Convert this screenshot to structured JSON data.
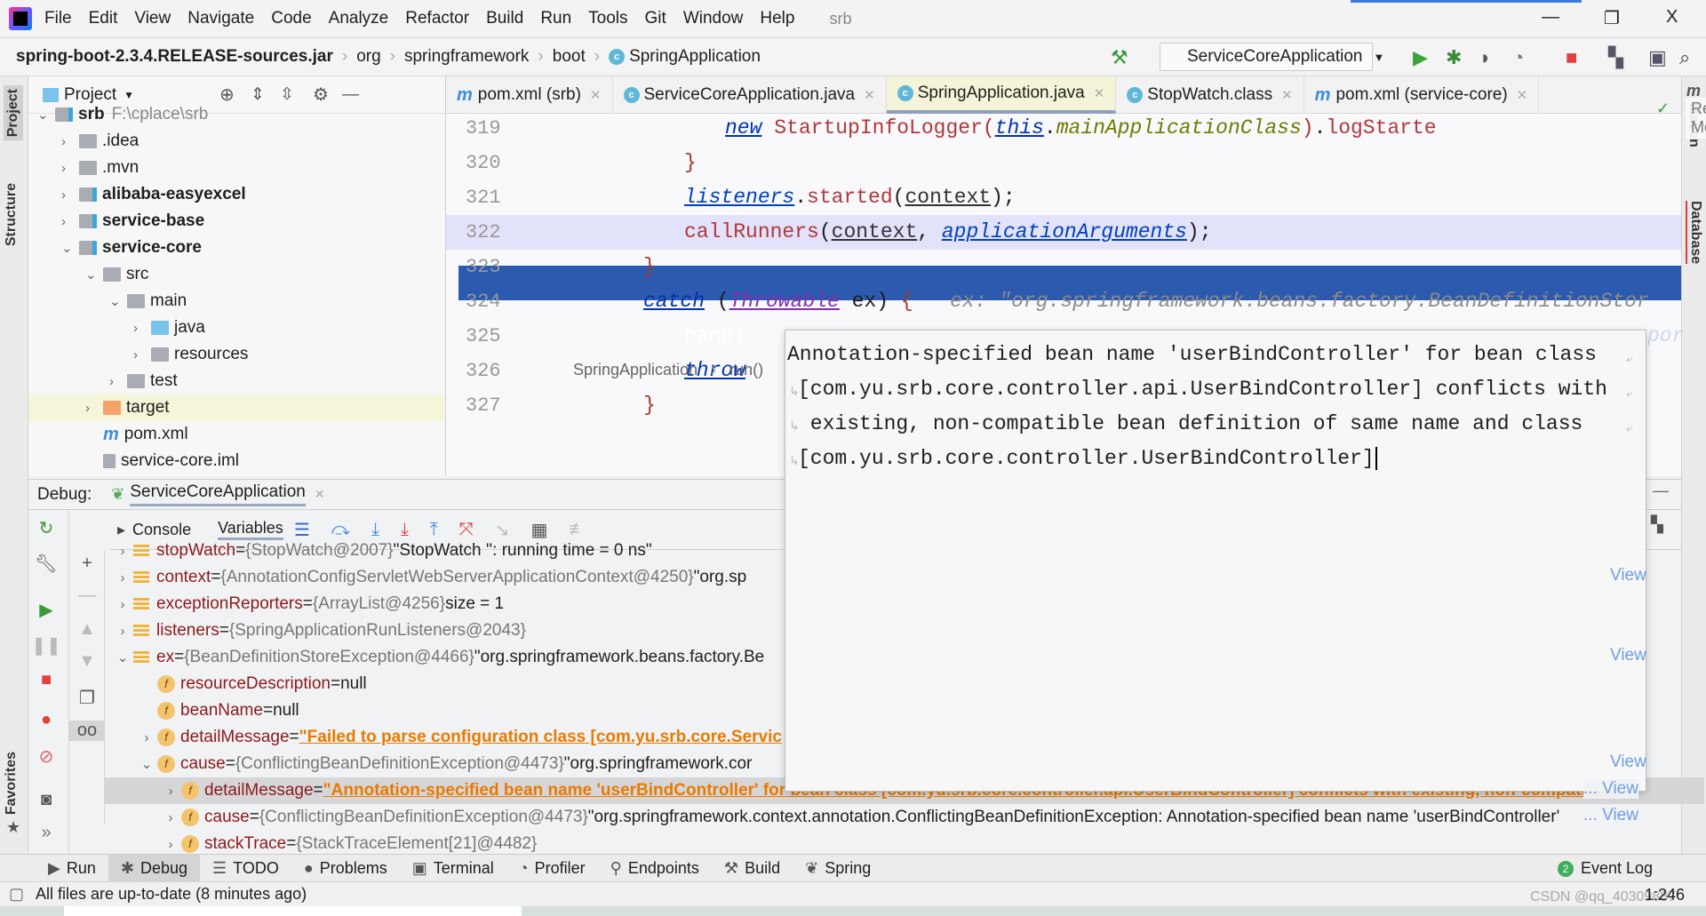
{
  "menu": {
    "items": [
      "File",
      "Edit",
      "View",
      "Navigate",
      "Code",
      "Analyze",
      "Refactor",
      "Build",
      "Run",
      "Tools",
      "Git",
      "Window",
      "Help"
    ],
    "project": "srb"
  },
  "window": {
    "minimize": "—",
    "restore": "❐",
    "close": "X"
  },
  "navbar": {
    "crumbs": [
      "spring-boot-2.3.4.RELEASE-sources.jar",
      "org",
      "springframework",
      "boot",
      "SpringApplication"
    ]
  },
  "toolbar": {
    "run_config": "ServiceCoreApplication"
  },
  "left_strip": {
    "tabs": [
      "Project",
      "Structure",
      "Favorites"
    ]
  },
  "right_strip": {
    "tabs": [
      "Maven",
      "Database"
    ]
  },
  "project": {
    "title": "Project",
    "tree": [
      {
        "name": "srb",
        "extra": "F:\\cplace\\srb",
        "level": 0,
        "arrow": "open",
        "icon": "module",
        "bold": true
      },
      {
        "name": ".idea",
        "level": 1,
        "arrow": "closed",
        "icon": "folder"
      },
      {
        "name": ".mvn",
        "level": 1,
        "arrow": "closed",
        "icon": "folder"
      },
      {
        "name": "alibaba-easyexcel",
        "level": 1,
        "arrow": "closed",
        "icon": "module",
        "bold": true
      },
      {
        "name": "service-base",
        "level": 1,
        "arrow": "closed",
        "icon": "module",
        "bold": true
      },
      {
        "name": "service-core",
        "level": 1,
        "arrow": "open",
        "icon": "module",
        "bold": true
      },
      {
        "name": "src",
        "level": 2,
        "arrow": "open",
        "icon": "folder"
      },
      {
        "name": "main",
        "level": 3,
        "arrow": "open",
        "icon": "folder"
      },
      {
        "name": "java",
        "level": 4,
        "arrow": "closed",
        "icon": "folder-blue"
      },
      {
        "name": "resources",
        "level": 4,
        "arrow": "closed",
        "icon": "folder"
      },
      {
        "name": "test",
        "level": 3,
        "arrow": "closed",
        "icon": "folder"
      },
      {
        "name": "target",
        "level": 2,
        "arrow": "closed",
        "icon": "folder-orange",
        "highlight": true
      },
      {
        "name": "pom.xml",
        "level": 2,
        "arrow": "none",
        "icon": "maven"
      },
      {
        "name": "service-core.iml",
        "level": 2,
        "arrow": "none",
        "icon": "file"
      }
    ]
  },
  "editor": {
    "tabs": [
      {
        "label": "pom.xml (srb)",
        "icon": "maven"
      },
      {
        "label": "ServiceCoreApplication.java",
        "icon": "class"
      },
      {
        "label": "SpringApplication.java",
        "icon": "class",
        "active": true
      },
      {
        "label": "StopWatch.class",
        "icon": "class"
      },
      {
        "label": "pom.xml (service-core)",
        "icon": "maven"
      }
    ],
    "reader_mode": "Reader Mode",
    "lines": [
      {
        "n": "319",
        "tokens": [
          [
            "new",
            "kw"
          ],
          [
            " ",
            ""
          ],
          [
            "StartupInfoLogger",
            "fn"
          ],
          [
            "(",
            "br"
          ],
          [
            "this",
            "kw"
          ],
          [
            ".",
            ""
          ],
          [
            "mainApplicationClass",
            "fld"
          ],
          [
            ")",
            "br"
          ],
          [
            ".",
            ""
          ],
          [
            "logStarte",
            "fn"
          ]
        ]
      },
      {
        "n": "320",
        "tokens": [
          [
            "}",
            "br"
          ]
        ]
      },
      {
        "n": "321",
        "tokens": [
          [
            "listeners",
            "var"
          ],
          [
            ".",
            ""
          ],
          [
            "started",
            "fn"
          ],
          [
            "(",
            ""
          ],
          [
            "context",
            "u"
          ],
          [
            ");",
            ""
          ]
        ]
      },
      {
        "n": "322",
        "highlight": true,
        "tokens": [
          [
            "callRunners",
            "fn"
          ],
          [
            "(",
            ""
          ],
          [
            "context",
            "u"
          ],
          [
            ", ",
            ""
          ],
          [
            "applicationArguments",
            "var"
          ],
          [
            ");",
            ""
          ]
        ]
      },
      {
        "n": "323",
        "tokens": [
          [
            "}",
            "br"
          ]
        ]
      },
      {
        "n": "324",
        "tokens": [
          [
            "catch",
            "kw"
          ],
          [
            " (",
            ""
          ],
          [
            "Throwable",
            "ty"
          ],
          [
            " ex) ",
            ""
          ],
          [
            "{",
            "br"
          ],
          [
            "   ex: \"org.springframework.beans.factory.BeanDefinitionStor",
            "cm"
          ]
        ]
      },
      {
        "n": "325",
        "selected": true,
        "tokens": [
          [
            "handl",
            "sel"
          ]
        ]
      },
      {
        "n": "326",
        "tokens": [
          [
            "throw",
            "kw"
          ]
        ]
      },
      {
        "n": "327",
        "tokens": [
          [
            "}",
            "br"
          ]
        ]
      }
    ],
    "line325_tail": "por",
    "breadcrumb": [
      "SpringApplication",
      "run()"
    ]
  },
  "popup": {
    "lines": [
      "Annotation-specified bean name 'userBindController' for bean class",
      "[com.yu.srb.core.controller.api.UserBindController] conflicts with",
      " existing, non-compatible bean definition of same name and class",
      "[com.yu.srb.core.controller.UserBindController]"
    ]
  },
  "debug": {
    "label": "Debug:",
    "session": "ServiceCoreApplication",
    "tabs": [
      "Console",
      "Variables"
    ],
    "variables": [
      {
        "level": 0,
        "arrow": "closed",
        "icon": "local",
        "name": "stopWatch",
        "type": "{StopWatch@2007}",
        "value": "\"StopWatch '': running time = 0 ns\""
      },
      {
        "level": 0,
        "arrow": "closed",
        "icon": "local",
        "name": "context",
        "type": "{AnnotationConfigServletWebServerApplicationContext@4250}",
        "value": "\"org.sp",
        "view": "View"
      },
      {
        "level": 0,
        "arrow": "closed",
        "icon": "local",
        "name": "exceptionReporters",
        "type": "{ArrayList@4256}",
        "value": "size = 1"
      },
      {
        "level": 0,
        "arrow": "closed",
        "icon": "local",
        "name": "listeners",
        "type": "{SpringApplicationRunListeners@2043}",
        "value": ""
      },
      {
        "level": 0,
        "arrow": "open",
        "icon": "local",
        "name": "ex",
        "type": "{BeanDefinitionStoreException@4466}",
        "value": "\"org.springframework.beans.factory.Be",
        "view": "View"
      },
      {
        "level": 1,
        "arrow": "none",
        "icon": "field",
        "name": "resourceDescription",
        "type": "",
        "value": "null"
      },
      {
        "level": 1,
        "arrow": "none",
        "icon": "field",
        "name": "beanName",
        "type": "",
        "value": "null"
      },
      {
        "level": 1,
        "arrow": "closed",
        "icon": "field",
        "name": "detailMessage",
        "type": "",
        "string": "\"Failed to parse configuration class [com.yu.srb.core.Servic"
      },
      {
        "level": 1,
        "arrow": "open",
        "icon": "field",
        "name": "cause",
        "type": "{ConflictingBeanDefinitionException@4473}",
        "value": "\"org.springframework.cor",
        "view": "View"
      },
      {
        "level": 2,
        "arrow": "closed",
        "icon": "field",
        "name": "detailMessage",
        "type": "",
        "string": "\"Annotation-specified bean name 'userBindController' for bean class [com.yu.srb.core.controller.api.UserBindController] conflicts with existing, non-compatible",
        "selected": true,
        "view": "... View"
      },
      {
        "level": 2,
        "arrow": "closed",
        "icon": "field",
        "name": "cause",
        "type": "{ConflictingBeanDefinitionException@4473}",
        "value": "\"org.springframework.context.annotation.ConflictingBeanDefinitionException: Annotation-specified bean name 'userBindController'",
        "view": "... View"
      },
      {
        "level": 2,
        "arrow": "closed",
        "icon": "field",
        "name": "stackTrace",
        "type": "{StackTraceElement[21]@4482}",
        "value": ""
      }
    ]
  },
  "bottom_tabs": [
    {
      "label": "Run",
      "icon": "▶"
    },
    {
      "label": "Debug",
      "icon": "✱",
      "active": true
    },
    {
      "label": "TODO",
      "icon": "☰"
    },
    {
      "label": "Problems",
      "icon": "●"
    },
    {
      "label": "Terminal",
      "icon": "▣"
    },
    {
      "label": "Profiler",
      "icon": "◔"
    },
    {
      "label": "Endpoints",
      "icon": "⚲"
    },
    {
      "label": "Build",
      "icon": "⚒"
    },
    {
      "label": "Spring",
      "icon": "❦"
    }
  ],
  "event_log": {
    "label": "Event Log",
    "count": "2"
  },
  "status": {
    "message": "All files are up-to-date (8 minutes ago)",
    "position": "1:246",
    "watermark": "CSDN @qq_40309887"
  }
}
